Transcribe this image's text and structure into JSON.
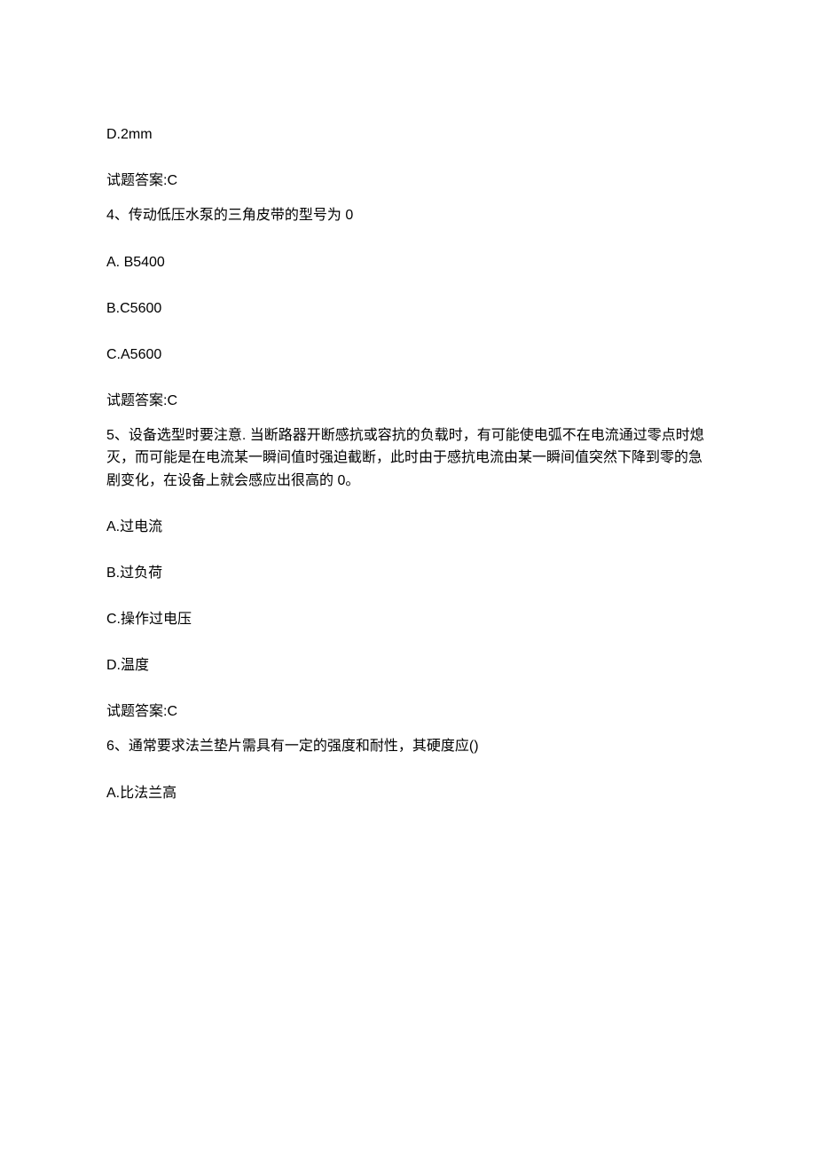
{
  "items": [
    {
      "type": "option",
      "text": "D.2mm"
    },
    {
      "type": "answer",
      "text": "试题答案:C"
    },
    {
      "type": "question",
      "text": "4、传动低压水泵的三角皮带的型号为 0"
    },
    {
      "type": "option",
      "text": "A.   B5400"
    },
    {
      "type": "option",
      "text": "B.C5600"
    },
    {
      "type": "option",
      "text": "C.A5600"
    },
    {
      "type": "answer",
      "text": "试题答案:C"
    },
    {
      "type": "question",
      "text": "5、设备选型时要注意. 当断路器开断感抗或容抗的负载时，有可能使电弧不在电流通过零点时熄灭，而可能是在电流某一瞬间值时强迫截断，此时由于感抗电流由某一瞬间值突然下降到零的急剧变化，在设备上就会感应出很高的 0。"
    },
    {
      "type": "option",
      "text": "A.过电流"
    },
    {
      "type": "option",
      "text": "B.过负荷"
    },
    {
      "type": "option",
      "text": "C.操作过电压"
    },
    {
      "type": "option",
      "text": "D.温度"
    },
    {
      "type": "answer",
      "text": "试题答案:C"
    },
    {
      "type": "question",
      "text": "6、通常要求法兰垫片需具有一定的强度和耐性，其硬度应()"
    },
    {
      "type": "option",
      "text": "A.比法兰高"
    }
  ]
}
